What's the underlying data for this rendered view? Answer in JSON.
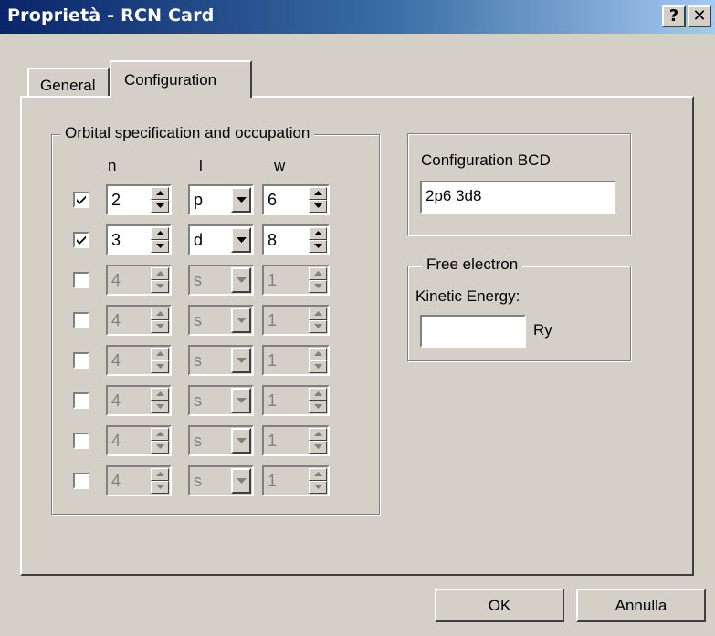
{
  "window": {
    "title": "Proprietà - RCN Card",
    "help_label": "?",
    "close_label": "✕"
  },
  "tabs": [
    {
      "label": "General",
      "active": false
    },
    {
      "label": "Configuration",
      "active": true
    }
  ],
  "orbitals": {
    "group_label": "Orbital specification and occupation",
    "col_n": "n",
    "col_l": "l",
    "col_w": "w",
    "rows": [
      {
        "checked": true,
        "n": "2",
        "l": "p",
        "w": "6",
        "enabled": true
      },
      {
        "checked": true,
        "n": "3",
        "l": "d",
        "w": "8",
        "enabled": true
      },
      {
        "checked": false,
        "n": "4",
        "l": "s",
        "w": "1",
        "enabled": false
      },
      {
        "checked": false,
        "n": "4",
        "l": "s",
        "w": "1",
        "enabled": false
      },
      {
        "checked": false,
        "n": "4",
        "l": "s",
        "w": "1",
        "enabled": false
      },
      {
        "checked": false,
        "n": "4",
        "l": "s",
        "w": "1",
        "enabled": false
      },
      {
        "checked": false,
        "n": "4",
        "l": "s",
        "w": "1",
        "enabled": false
      },
      {
        "checked": false,
        "n": "4",
        "l": "s",
        "w": "1",
        "enabled": false
      }
    ]
  },
  "configuration_bcd": {
    "label": "Configuration BCD",
    "value": "2p6 3d8"
  },
  "free_electron": {
    "group_label": "Free electron",
    "kinetic_label": "Kinetic Energy:",
    "value": "",
    "unit": "Ry"
  },
  "buttons": {
    "ok": "OK",
    "cancel": "Annulla"
  },
  "colors": {
    "title_start": "#0a246a",
    "title_end": "#a6caf0",
    "face": "#d4d0c8",
    "disabled_text": "#808080"
  }
}
